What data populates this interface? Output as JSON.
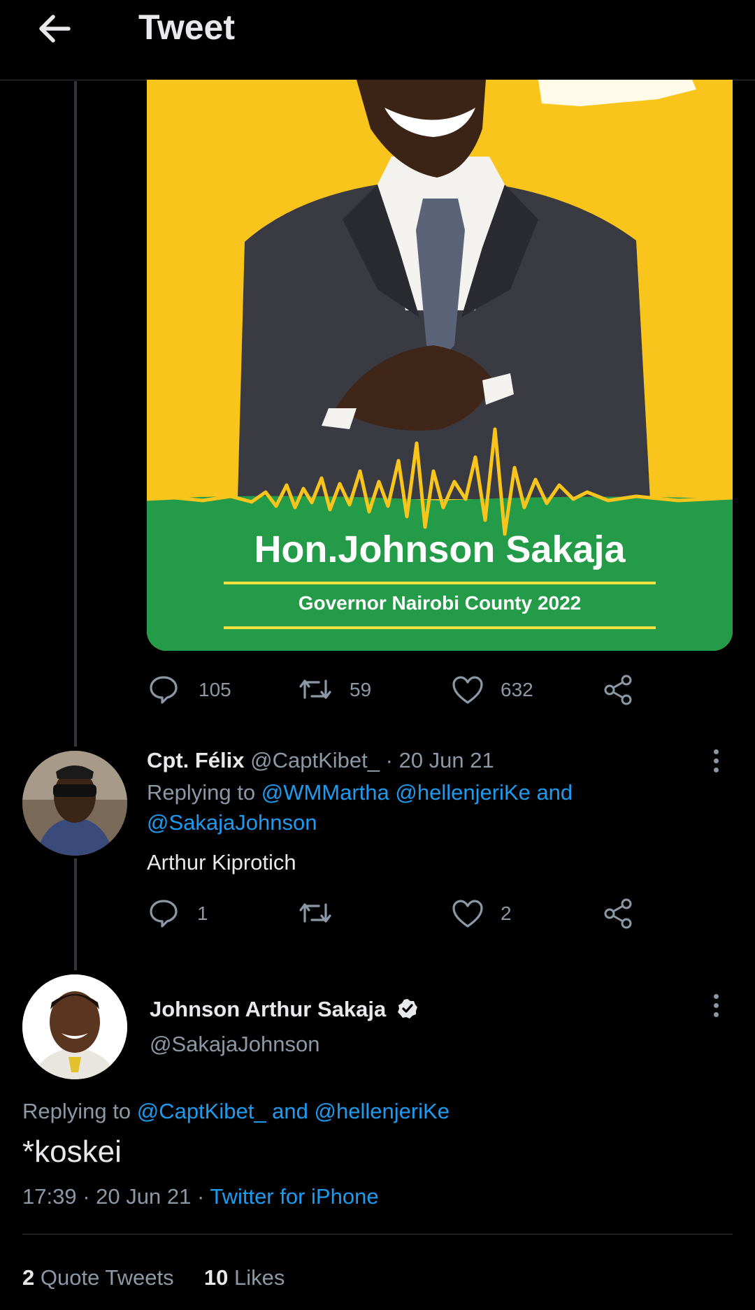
{
  "header": {
    "title": "Tweet"
  },
  "poster": {
    "name_text": "Hon.Johnson Sakaja",
    "subtitle_text": "Governor Nairobi County 2022"
  },
  "main_tweet_actions": {
    "replies": "105",
    "retweets": "59",
    "likes": "632"
  },
  "reply": {
    "display_name": "Cpt. Félix",
    "handle": "@CaptKibet_",
    "separator": "·",
    "date": "20 Jun 21",
    "replying_prefix": "Replying to",
    "replying_line1": "@WMMartha @hellenjeriKe and",
    "replying_line2": "@SakajaJohnson",
    "text": "Arthur Kiprotich",
    "actions": {
      "replies": "1",
      "likes": "2"
    }
  },
  "focus_tweet": {
    "display_name": "Johnson Arthur Sakaja",
    "handle": "@SakajaJohnson",
    "replying_prefix": "Replying to",
    "replying_links": "@CaptKibet_ and @hellenjeriKe",
    "text": "*koskei",
    "time": "17:39",
    "dot1": "·",
    "date": "20 Jun 21",
    "dot2": "·",
    "source": "Twitter for iPhone",
    "stats": {
      "quote_count": "2",
      "quote_label": "Quote Tweets",
      "like_count": "10",
      "like_label": "Likes"
    }
  },
  "colors": {
    "background": "#000000",
    "link": "#1d9bf0",
    "muted": "#8b98a5",
    "poster_yellow": "#f9c51c",
    "poster_green": "#239b48"
  }
}
